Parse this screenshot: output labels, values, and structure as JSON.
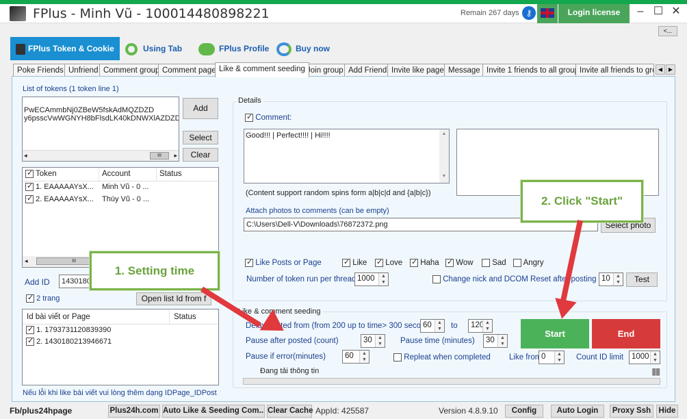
{
  "window": {
    "title": "FPlus - Minh Vũ - 100014480898221",
    "remain": "Remain 267 days",
    "login_button": "Login license",
    "collapse_button": "<..."
  },
  "main_tabs": [
    {
      "label": "FPlus Token & Cookie",
      "icon": "fplus-token-icon"
    },
    {
      "label": "Using Tab",
      "icon": "chain-link-icon"
    },
    {
      "label": "FPlus Profile",
      "icon": "people-icon"
    },
    {
      "label": "Buy now",
      "icon": "buy-refresh-icon"
    }
  ],
  "sub_tabs": [
    "Poke Friends",
    "Unfriend",
    "Comment group",
    "Comment page",
    "Like & comment seeding",
    "Join group",
    "Add Friend",
    "Invite like page",
    "Message",
    "Invite 1 friends to all group",
    "Invite all friends to gro"
  ],
  "tokens": {
    "label": "List of tokens (1 token line 1)",
    "lines": [
      "PwECAmmbNj0ZBeW5fskAdMQZDZD",
      "y6psscVwWGNYH8bFlsdLK40kDNWXlAZDZD"
    ],
    "add": "Add",
    "select": "Select",
    "clear": "Clear"
  },
  "token_table": {
    "headers": [
      "Token",
      "Account",
      "Status"
    ],
    "rows": [
      {
        "token": "1. EAAAAAYsX...",
        "account": "Minh Vũ - 0 ...",
        "status": ""
      },
      {
        "token": "2. EAAAAAYsX...",
        "account": "Thúy Vũ - 0 ...",
        "status": ""
      }
    ]
  },
  "add_id": {
    "label": "Add ID",
    "value": "1430180",
    "open_button": "Open list Id from f",
    "two_page": "2 trang"
  },
  "posts_table": {
    "headers": [
      "Id bài viết or Page",
      "Status"
    ],
    "rows": [
      "1. 1793731120839390",
      "2. 1430180213946671"
    ]
  },
  "footer_note": "Nếu lỗi khi like bài viết vui lòng thêm dạng IDPage_IDPost",
  "details": {
    "title": "Details",
    "comment_label": "Comment:",
    "comment_text": "Good!!! | Perfect!!!! | Hi!!!!",
    "spin_note": "(Content support random spins form a|b|c|d and {a|b|c})",
    "attach_label": "Attach photos to comments (can be empty)",
    "attach_path": "C:\\Users\\Dell-V\\Downloads\\76872372.png",
    "select_photo": "Select photo",
    "like_posts": "Like Posts or Page",
    "reactions": [
      "Like",
      "Love",
      "Haha",
      "Wow",
      "Sad",
      "Angry"
    ],
    "threads_label": "Number of token run per thread:",
    "threads_value": "1000",
    "change_nick": "Change nick and DCOM Reset after posting is",
    "change_value": "10",
    "test": "Test"
  },
  "seeding": {
    "title": "Like & comment seeding",
    "delay_label": "Delay posted from (from 200 up to time> 300 seconds)",
    "delay_from": "60",
    "to_label": "to",
    "delay_to": "120",
    "pause_after_label": "Pause after posted (count)",
    "pause_after": "30",
    "pause_time_label": "Pause time (minutes)",
    "pause_time": "30",
    "pause_error_label": "Pause if error(minutes)",
    "pause_error": "60",
    "repeat": "Repleat when completed",
    "like_from_label": "Like from",
    "like_from": "0",
    "count_label": "Count ID limit",
    "count_value": "1000",
    "status": "Đang tải thông tin",
    "start": "Start",
    "end": "End"
  },
  "callouts": {
    "one": "1. Setting time",
    "two": "2. Click \"Start\""
  },
  "bottom": {
    "link": "Fb/plus24hpage",
    "buttons": [
      "Plus24h.com",
      "Auto Like & Seeding Com...",
      "Clear Cache"
    ],
    "appid": "AppId: 425587",
    "version": "Version 4.8.9.10",
    "right_buttons": [
      "Config",
      "Auto Login",
      "Proxy Ssh",
      "Hide"
    ]
  },
  "colors": {
    "start": "#4cb25a",
    "end": "#d73a3a",
    "accent": "#13a84e",
    "tab_active": "#1a8fd1"
  }
}
